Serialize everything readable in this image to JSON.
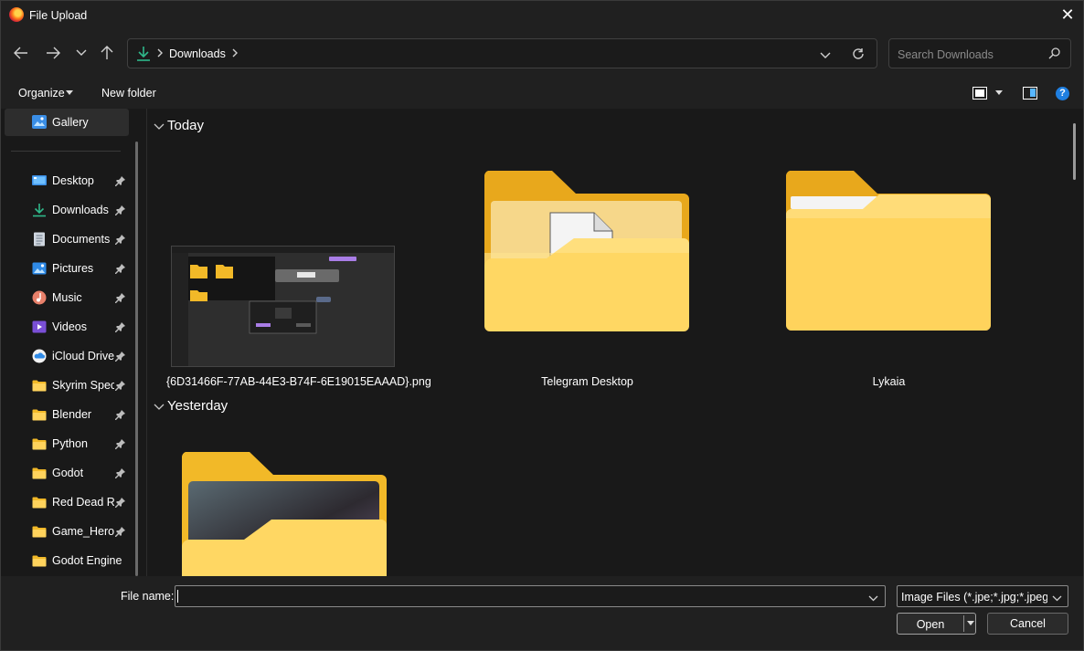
{
  "window": {
    "title": "File Upload"
  },
  "nav": {
    "path_segment": "Downloads",
    "search_placeholder": "Search Downloads"
  },
  "commandbar": {
    "organize": "Organize",
    "new_folder": "New folder"
  },
  "sidebar": {
    "gallery": "Gallery",
    "items": [
      {
        "label": "Desktop",
        "icon": "desktop-icon",
        "pinned": true
      },
      {
        "label": "Downloads",
        "icon": "downloads-icon",
        "pinned": true
      },
      {
        "label": "Documents",
        "icon": "documents-icon",
        "pinned": true
      },
      {
        "label": "Pictures",
        "icon": "pictures-icon",
        "pinned": true
      },
      {
        "label": "Music",
        "icon": "music-icon",
        "pinned": true
      },
      {
        "label": "Videos",
        "icon": "videos-icon",
        "pinned": true
      },
      {
        "label": "iCloud Drive",
        "icon": "icloud-icon",
        "pinned": true
      },
      {
        "label": "Skyrim Speci",
        "icon": "folder-icon",
        "pinned": true
      },
      {
        "label": "Blender",
        "icon": "folder-icon",
        "pinned": true
      },
      {
        "label": "Python",
        "icon": "folder-icon",
        "pinned": true
      },
      {
        "label": "Godot",
        "icon": "folder-icon",
        "pinned": true
      },
      {
        "label": "Red Dead Re",
        "icon": "folder-icon",
        "pinned": true
      },
      {
        "label": "Game_Heroe",
        "icon": "folder-icon",
        "pinned": true
      },
      {
        "label": "Godot Engine",
        "icon": "folder-icon",
        "pinned": false
      }
    ]
  },
  "content": {
    "groups": [
      {
        "header": "Today",
        "items": [
          {
            "name": "{6D31466F-77AB-44E3-B74F-6E19015EAAAD}.png",
            "type": "image"
          },
          {
            "name": "Telegram Desktop",
            "type": "folder"
          },
          {
            "name": "Lykaia",
            "type": "folder"
          }
        ]
      },
      {
        "header": "Yesterday",
        "items": [
          {
            "name": "",
            "type": "folder"
          }
        ]
      }
    ]
  },
  "bottom": {
    "file_name_label": "File name:",
    "file_name_value": "",
    "filter": "Image Files (*.jpe;*.jpg;*.jpeg;*.",
    "open": "Open",
    "cancel": "Cancel"
  },
  "colors": {
    "accent": "#1f7fe0",
    "folder": "#f7c340",
    "background": "#191919",
    "chrome": "#202020"
  }
}
